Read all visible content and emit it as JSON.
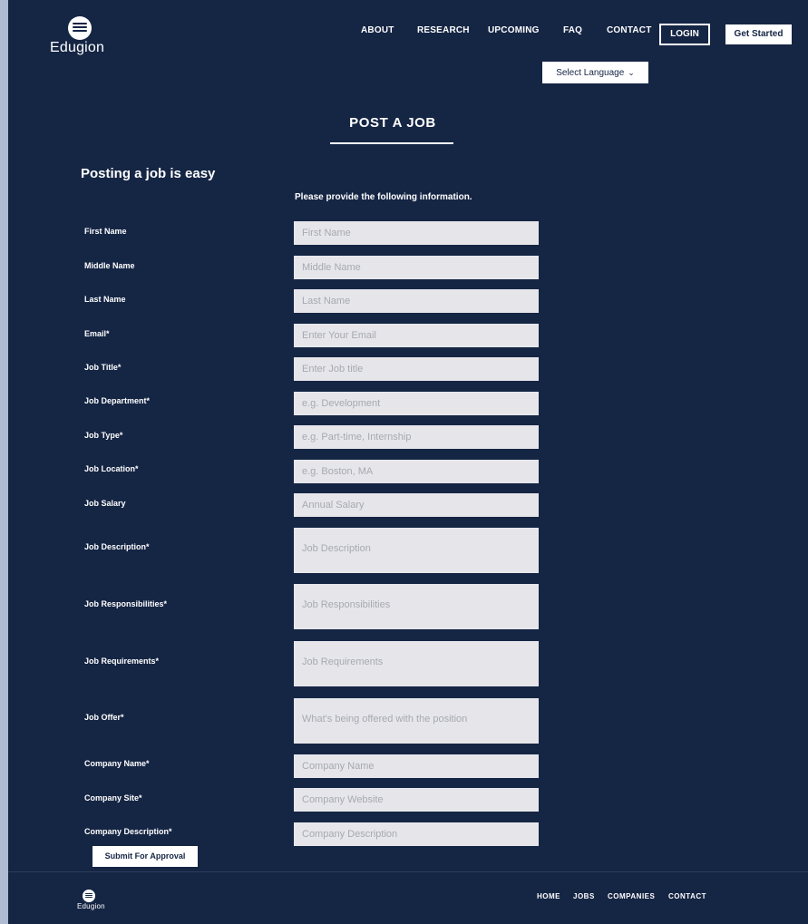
{
  "header": {
    "brand": "Edugion",
    "nav": [
      "ABOUT",
      "RESEARCH",
      "UPCOMING",
      "FAQ",
      "CONTACT"
    ],
    "login_label": "LOGIN",
    "get_started_label": "Get Started",
    "language": "Select Language"
  },
  "main": {
    "title": "POST A JOB",
    "subtitle": "Posting a job is easy",
    "instructions": "Please provide the following information.",
    "fields": [
      {
        "label": "First Name",
        "placeholder": "First Name",
        "value": ""
      },
      {
        "label": "Middle Name",
        "placeholder": "Middle Name",
        "value": ""
      },
      {
        "label": "Last Name",
        "placeholder": "Last Name",
        "value": ""
      },
      {
        "label": "Email*",
        "placeholder": "Enter Your Email",
        "value": ""
      },
      {
        "label": "Job Title*",
        "placeholder": "Enter Job title",
        "value": ""
      },
      {
        "label": "Job Department*",
        "placeholder": "e.g. Development",
        "value": ""
      },
      {
        "label": "Job Type*",
        "placeholder": "e.g. Part-time, Internship",
        "value": ""
      },
      {
        "label": "Job Location*",
        "placeholder": "e.g. Boston, MA",
        "value": ""
      },
      {
        "label": "Job Salary",
        "placeholder": "Annual Salary",
        "value": ""
      },
      {
        "label": "Job Description*",
        "placeholder": "Job Description",
        "value": ""
      },
      {
        "label": "Job Responsibilities*",
        "placeholder": "Job Responsibilities",
        "value": ""
      },
      {
        "label": "Job Requirements*",
        "placeholder": "Job Requirements",
        "value": ""
      },
      {
        "label": "Job Offer*",
        "placeholder": "What's being offered with the position",
        "value": ""
      },
      {
        "label": "Company Name*",
        "placeholder": "Company Name",
        "value": ""
      },
      {
        "label": "Company Site*",
        "placeholder": "Company Website",
        "value": ""
      },
      {
        "label": "Company Description*",
        "placeholder": "Company Description",
        "value": ""
      }
    ],
    "submit_label": "Submit For Approval"
  },
  "footer": {
    "brand": "Edugion",
    "nav": [
      "HOME",
      "JOBS",
      "COMPANIES",
      "CONTACT"
    ]
  },
  "colors": {
    "background": "#152544",
    "field": "#e6e6ea",
    "outer": "#aebbd0"
  }
}
